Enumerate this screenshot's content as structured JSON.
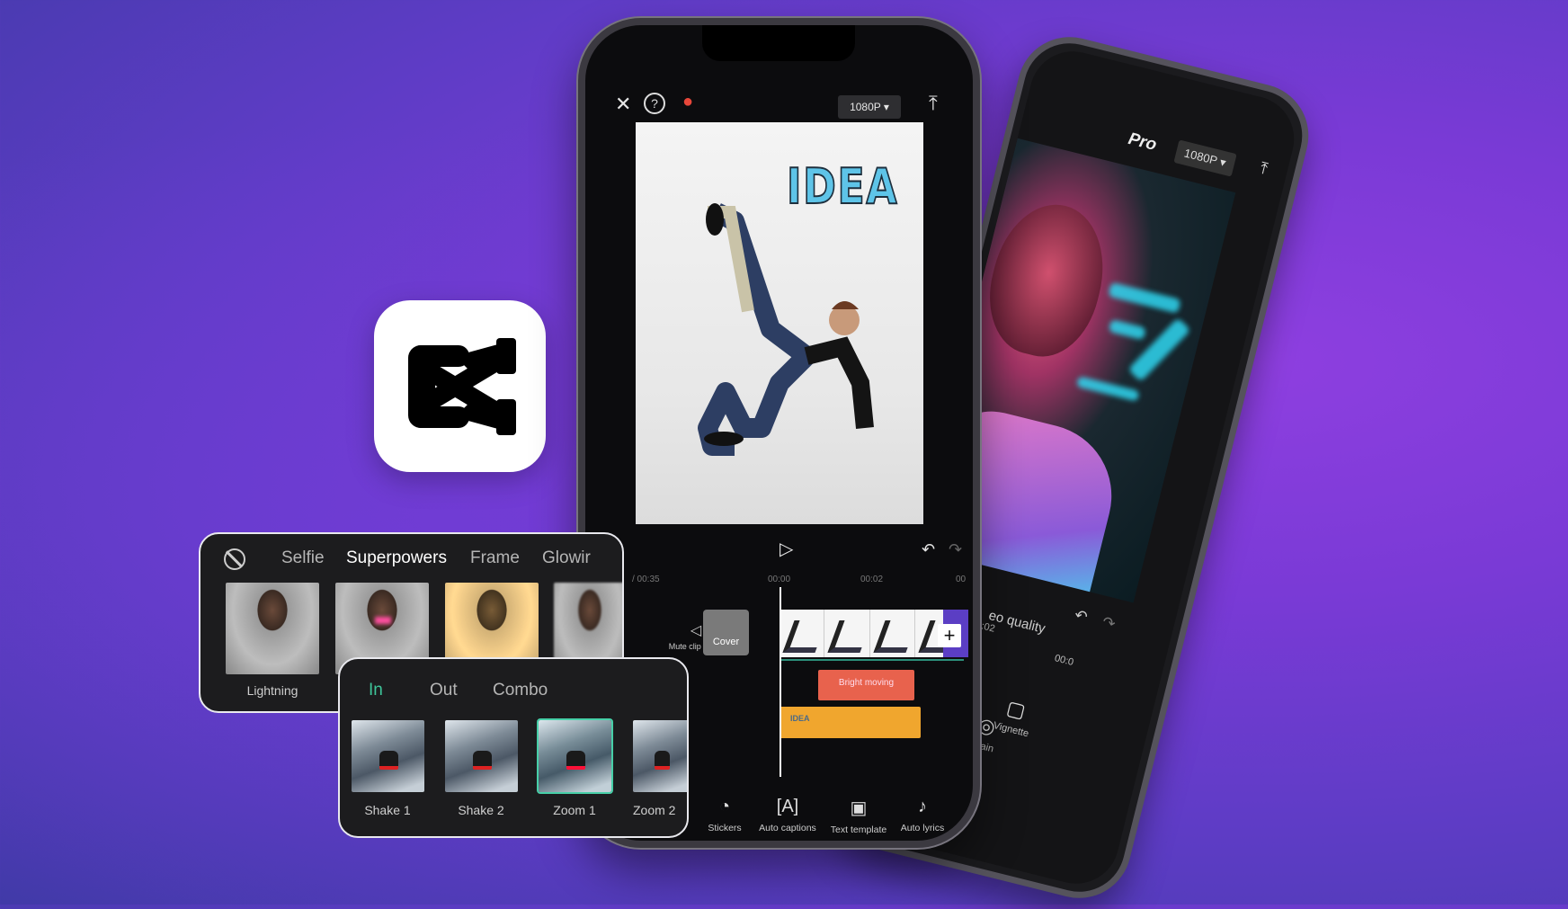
{
  "colors": {
    "background": "#6a3cd0",
    "accent_green": "#3ec59a",
    "flame": "#e8473a",
    "bright_clip": "#e8624d",
    "text_clip": "#f0a62e"
  },
  "app_icon": {
    "name": "capcut-logo"
  },
  "back_phone": {
    "brand": "Pro",
    "resolution": "1080P",
    "time_label": "00:02",
    "time_label_2": "00:0",
    "setting_label": "eo quality",
    "tools": [
      {
        "label": "Vignette",
        "icon": "vignette-icon"
      },
      {
        "label": "Grain",
        "icon": "grain-icon"
      }
    ]
  },
  "editor": {
    "resolution": "1080P",
    "preview_text": "IDEA",
    "timeline": {
      "duration": "/ 00:35",
      "ticks": [
        "00:00",
        "00:02",
        "00"
      ]
    },
    "mute_label": "Mute clip audio",
    "cover_label": "Cover",
    "clips": {
      "effect": "Bright moving",
      "text": "IDEA"
    },
    "toolbar": [
      {
        "label": "Stickers",
        "icon": "sticker-icon"
      },
      {
        "label": "Auto captions",
        "icon": "auto-captions-icon"
      },
      {
        "label": "Text template",
        "icon": "text-template-icon"
      },
      {
        "label": "Auto lyrics",
        "icon": "auto-lyrics-icon"
      }
    ]
  },
  "effects_panel": {
    "tabs": [
      "Selfie",
      "Superpowers",
      "Frame",
      "Glowir"
    ],
    "active_tab": "Superpowers",
    "items": [
      "Lightning"
    ]
  },
  "animation_panel": {
    "tabs": [
      "In",
      "Out",
      "Combo"
    ],
    "active_tab": "In",
    "items": [
      "Shake 1",
      "Shake 2",
      "Zoom 1",
      "Zoom 2"
    ],
    "selected_item": "Zoom 1"
  }
}
